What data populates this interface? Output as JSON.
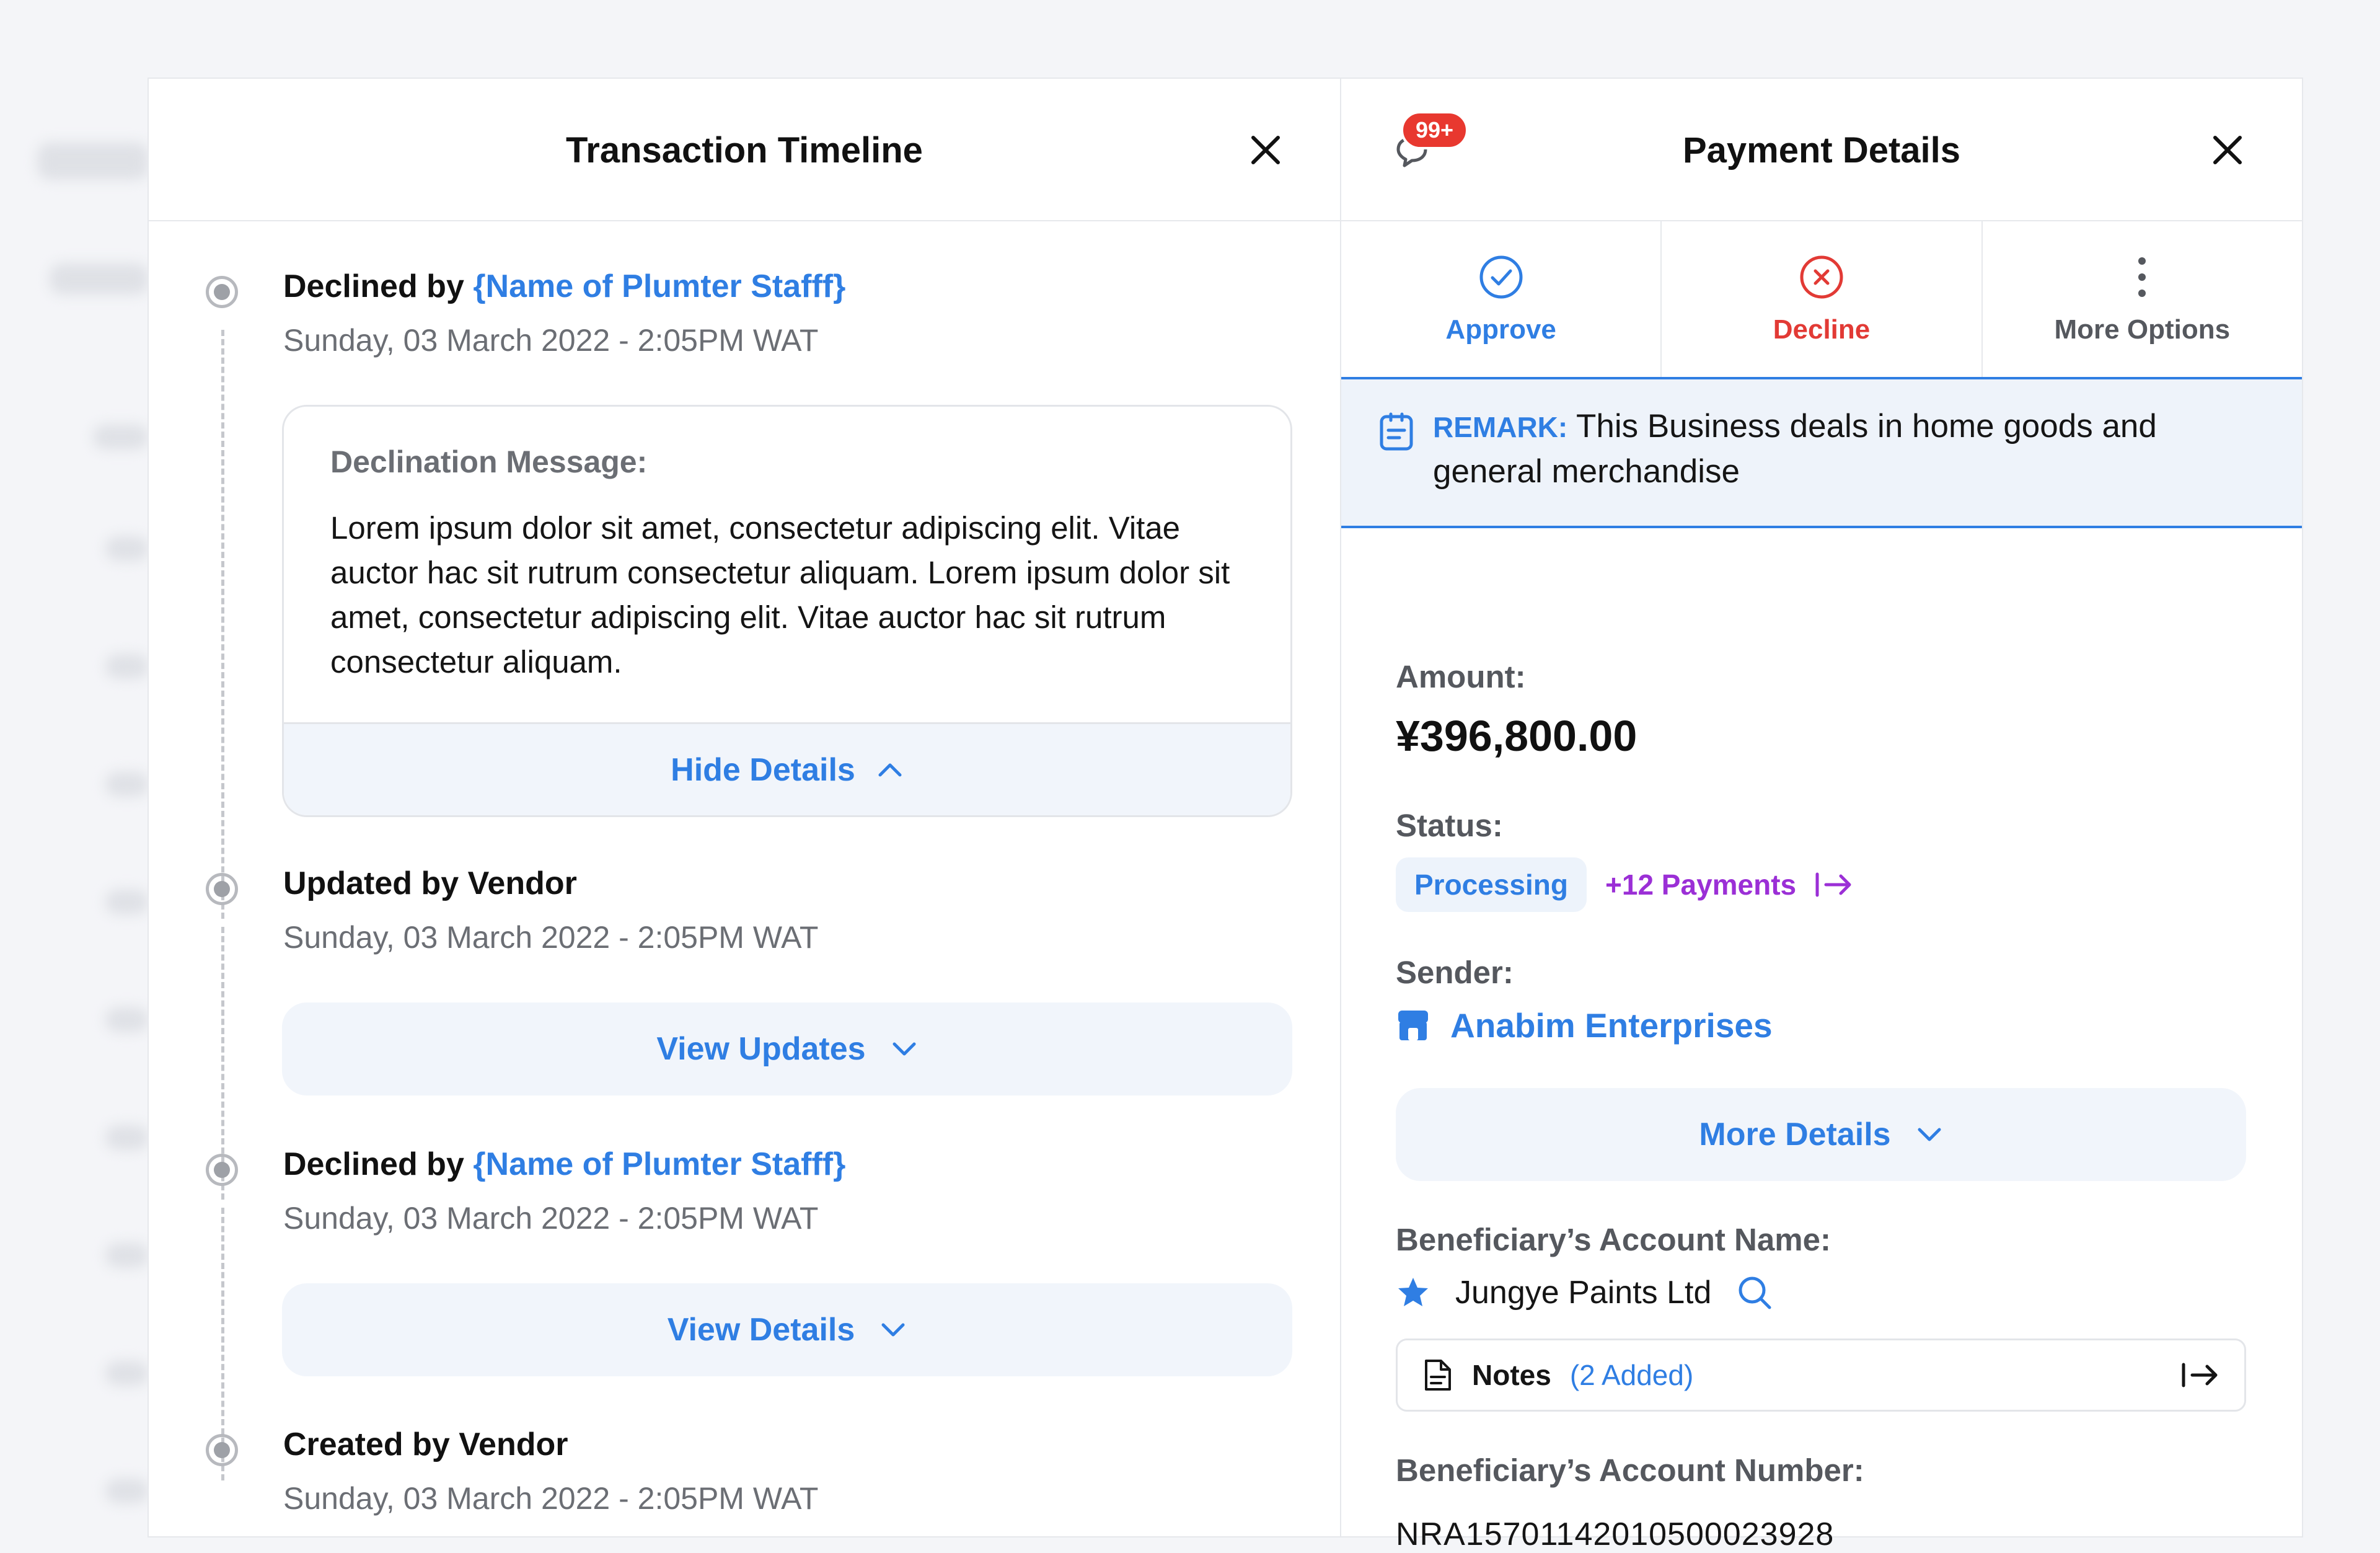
{
  "timeline": {
    "title": "Transaction Timeline",
    "events": [
      {
        "title_prefix": "Declined by ",
        "title_link": "{Name of Plumter Stafff}",
        "date": "Sunday, 03 March 2022 - 2:05PM WAT",
        "box_label": "Declination Message:",
        "message": "Lorem ipsum dolor sit amet, consectetur adipiscing elit. Vitae auctor hac sit rutrum consectetur aliquam. Lorem ipsum dolor sit amet, consectetur adipiscing elit. Vitae auctor hac sit rutrum consectetur aliquam.",
        "button": "Hide Details"
      },
      {
        "title": "Updated by Vendor",
        "date": "Sunday, 03 March 2022 - 2:05PM WAT",
        "button": "View Updates"
      },
      {
        "title_prefix": "Declined by ",
        "title_link": "{Name of Plumter Stafff}",
        "date": "Sunday, 03 March 2022 - 2:05PM WAT",
        "button": "View Details"
      },
      {
        "title": "Created by Vendor",
        "date": "Sunday, 03 March 2022 - 2:05PM WAT"
      }
    ]
  },
  "details": {
    "title": "Payment Details",
    "notification_badge": "99+",
    "actions": {
      "approve": "Approve",
      "decline": "Decline",
      "more": "More Options"
    },
    "remark": {
      "key": "REMARK:",
      "text": "This Business deals in home goods and general merchandise"
    },
    "amount_label": "Amount:",
    "amount": "¥396,800.00",
    "status_label": "Status:",
    "status": "Processing",
    "payments_link": "+12 Payments",
    "sender_label": "Sender:",
    "sender": "Anabim Enterprises",
    "more_details": "More Details",
    "beneficiary_name_label": "Beneficiary’s Account Name:",
    "beneficiary_name": "Jungye Paints Ltd",
    "notes_label": "Notes",
    "notes_count": "(2 Added)",
    "beneficiary_number_label": "Beneficiary’s Account Number:",
    "beneficiary_number": "NRA15701142010500023928"
  },
  "colors": {
    "accent": "#2f7ee3",
    "decline": "#e23a35",
    "purple": "#9b2fd6",
    "badge": "#e8382f"
  }
}
